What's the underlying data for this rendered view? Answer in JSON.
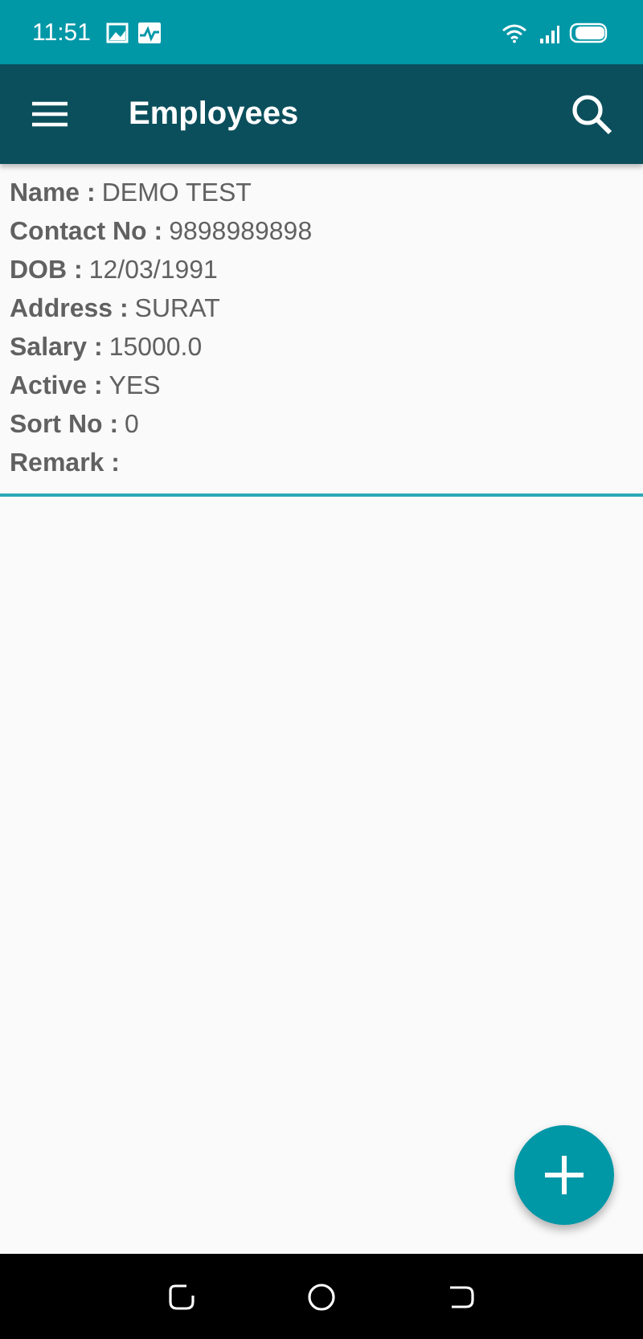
{
  "status_bar": {
    "time": "11:51"
  },
  "app_bar": {
    "title": "Employees"
  },
  "employees": [
    {
      "fields": [
        {
          "label": "Name :",
          "value": "DEMO TEST"
        },
        {
          "label": "Contact No :",
          "value": "9898989898"
        },
        {
          "label": "DOB :",
          "value": "12/03/1991"
        },
        {
          "label": "Address :",
          "value": "SURAT"
        },
        {
          "label": "Salary :",
          "value": "15000.0"
        },
        {
          "label": "Active :",
          "value": "YES"
        },
        {
          "label": "Sort No :",
          "value": "0"
        },
        {
          "label": "Remark :"
        }
      ]
    }
  ]
}
